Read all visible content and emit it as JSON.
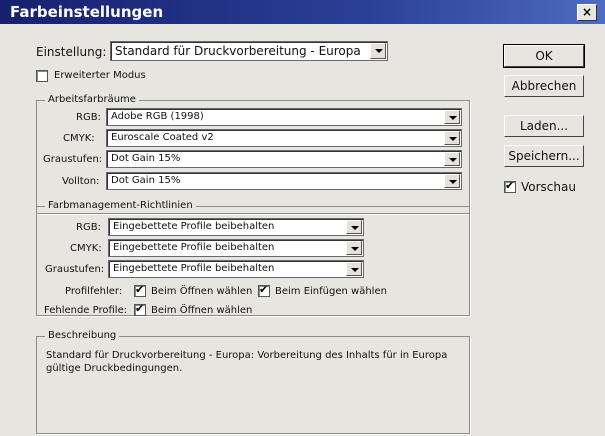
{
  "window": {
    "title": "Farbeinstellungen",
    "close_glyph": "×"
  },
  "einstellung": {
    "label": "Einstellung:",
    "value": "Standard für Druckvorbereitung - Europa"
  },
  "erweiterter_modus": {
    "label": "Erweiterter Modus",
    "checked": false
  },
  "arbeitsfarbraeume": {
    "title": "Arbeitsfarbräume",
    "rows": [
      {
        "label": "RGB:",
        "value": "Adobe RGB (1998)"
      },
      {
        "label": "CMYK:",
        "value": "Euroscale Coated v2"
      },
      {
        "label": "Graustufen:",
        "value": "Dot Gain 15%"
      },
      {
        "label": "Vollton:",
        "value": "Dot Gain 15%"
      }
    ]
  },
  "richtlinien": {
    "title": "Farbmanagement-Richtlinien",
    "rows": [
      {
        "label": "RGB:",
        "value": "Eingebettete Profile beibehalten"
      },
      {
        "label": "CMYK:",
        "value": "Eingebettete Profile beibehalten"
      },
      {
        "label": "Graustufen:",
        "value": "Eingebettete Profile beibehalten"
      }
    ],
    "profilfehler_label": "Profilfehler:",
    "beim_oeffnen_waehlen": "Beim Öffnen wählen",
    "beim_einfuegen_waehlen": "Beim Einfügen wählen",
    "fehlende_profile_label": "Fehlende Profile:",
    "fehlende_beim_oeffnen_waehlen": "Beim Öffnen wählen"
  },
  "beschreibung": {
    "title": "Beschreibung",
    "text_line1": "Standard für Druckvorbereitung - Europa:  Vorbereitung des Inhalts für in Europa",
    "text_line2": "gültige Druckbedingungen."
  },
  "buttons": {
    "ok": "OK",
    "abbrechen": "Abbrechen",
    "laden": "Laden...",
    "speichern": "Speichern..."
  },
  "vorschau": {
    "label": "Vorschau",
    "checked": true
  }
}
